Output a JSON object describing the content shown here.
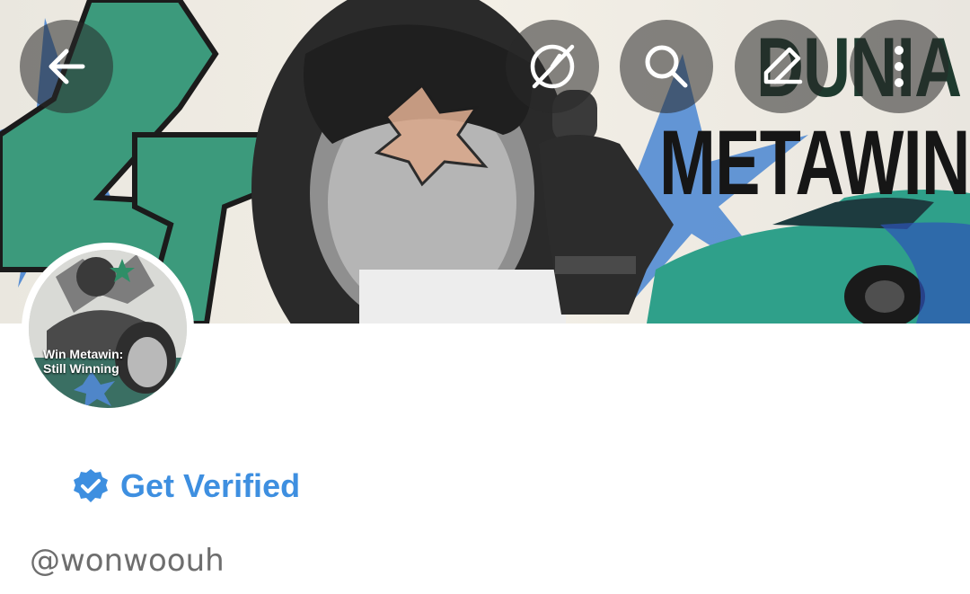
{
  "header": {
    "banner_title_line1": "DUNIA",
    "banner_title_line2": "METAWIN",
    "buttons": [
      {
        "name": "back",
        "icon": "arrow-left-icon"
      },
      {
        "name": "explore",
        "icon": "compass-slash-icon"
      },
      {
        "name": "search",
        "icon": "search-icon"
      },
      {
        "name": "edit",
        "icon": "pencil-icon"
      },
      {
        "name": "more",
        "icon": "more-vertical-icon"
      }
    ]
  },
  "profile": {
    "avatar_caption": "Win Metawin:\nStill Winning",
    "get_verified_label": "Get Verified",
    "handle": "@wonwoouh"
  },
  "colors": {
    "accent": "#3e8fe0",
    "banner_green": "#3c9a7c",
    "banner_blue": "#3f7fd1",
    "overlay": "#282828"
  }
}
